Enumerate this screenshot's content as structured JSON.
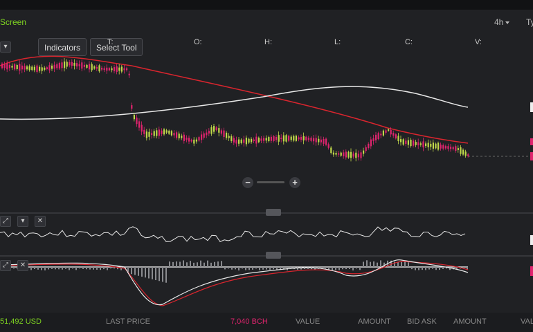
{
  "toolbar": {
    "screen_label": "Screen",
    "interval": "4h",
    "type_label": "Ty",
    "indicators_label": "Indicators",
    "select_tool_label": "Select Tool",
    "time_label": "T:",
    "ohlc": {
      "open": "O:",
      "high": "H:",
      "low": "L:",
      "close": "C:",
      "volume": "V:"
    }
  },
  "footer": {
    "balance": "51,492 USD",
    "last_price_label": "LAST PRICE",
    "bch_amount": "7,040 BCH",
    "value_label": "VALUE",
    "amount_label": "AMOUNT",
    "bid_ask_label": "BID  ASK",
    "amount_label_2": "AMOUNT",
    "value_label_2": "VAL"
  },
  "colors": {
    "background": "#202124",
    "up_candle": "#c0d84a",
    "down_candle": "#e0246e",
    "ma_red": "#d9252e",
    "ma_white": "#e8e8e8",
    "balance_green": "#7ed321",
    "bch_pink": "#e0246e"
  },
  "icons": {
    "expand": "expand-icon",
    "arrow_down": "arrow-down-icon",
    "close": "close-icon",
    "zoom_out": "minus-icon",
    "zoom_in": "plus-icon",
    "drag_handle": "drag-handle-icon"
  }
}
